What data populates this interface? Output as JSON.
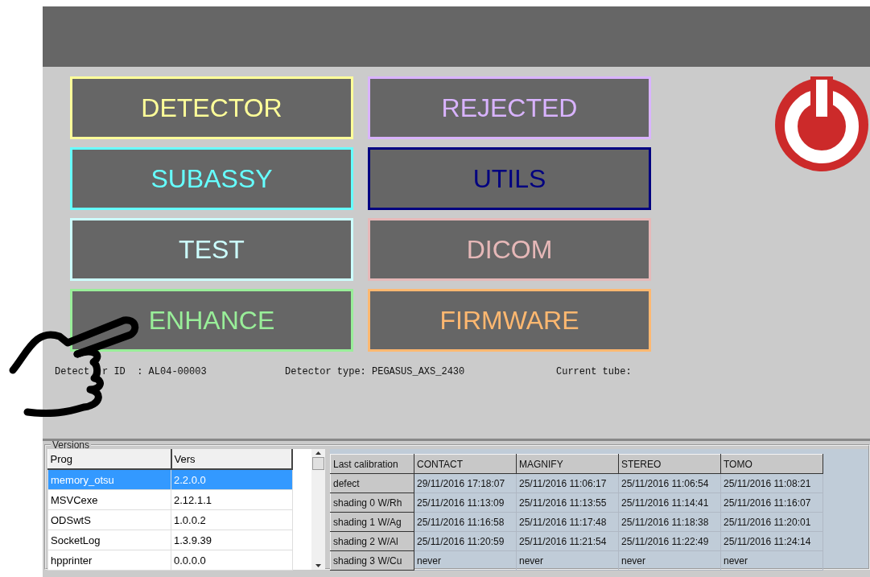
{
  "buttons": [
    {
      "label": "DETECTOR",
      "color": "#ffff99"
    },
    {
      "label": "REJECTED",
      "color": "#d9b3ff"
    },
    {
      "label": "SUBASSY",
      "color": "#66ffff"
    },
    {
      "label": "UTILS",
      "color": "#000080"
    },
    {
      "label": "TEST",
      "color": "#ccffff"
    },
    {
      "label": "DICOM",
      "color": "#e6b8b8"
    },
    {
      "label": "ENHANCE",
      "color": "#99ee99"
    },
    {
      "label": "FIRMWARE",
      "color": "#ffb870"
    }
  ],
  "info": [
    "Detect",
    "r ID  : AL04-00003",
    "Detector type: PEGASUS_AXS_2430",
    "Current tube:"
  ],
  "versions": {
    "title": "Versions",
    "columns": [
      "Prog",
      "Vers"
    ],
    "rows": [
      {
        "cells": [
          "memory_otsu",
          "2.2.0.0"
        ],
        "selected": true
      },
      {
        "cells": [
          "MSVCexe",
          "2.12.1.1"
        ],
        "selected": false
      },
      {
        "cells": [
          "ODSwtS",
          "1.0.0.2"
        ],
        "selected": false
      },
      {
        "cells": [
          "SocketLog",
          "1.3.9.39"
        ],
        "selected": false
      },
      {
        "cells": [
          "hpprinter",
          "0.0.0.0"
        ],
        "selected": false
      }
    ]
  },
  "calibration": {
    "corner": "Last calibration",
    "columns": [
      "CONTACT",
      "MAGNIFY",
      "STEREO",
      "TOMO"
    ],
    "rows": [
      {
        "label": "defect",
        "cells": [
          "29/11/2016 17:18:07",
          "25/11/2016 11:06:17",
          "25/11/2016 11:06:54",
          "25/11/2016 11:08:21"
        ]
      },
      {
        "label": "shading 0 W/Rh",
        "cells": [
          "25/11/2016 11:13:09",
          "25/11/2016 11:13:55",
          "25/11/2016 11:14:41",
          "25/11/2016 11:16:07"
        ]
      },
      {
        "label": "shading 1 W/Ag",
        "cells": [
          "25/11/2016 11:16:58",
          "25/11/2016 11:17:48",
          "25/11/2016 11:18:38",
          "25/11/2016 11:20:01"
        ]
      },
      {
        "label": "shading 2 W/Al",
        "cells": [
          "25/11/2016 11:20:59",
          "25/11/2016 11:21:54",
          "25/11/2016 11:22:49",
          "25/11/2016 11:24:14"
        ]
      },
      {
        "label": "shading 3 W/Cu",
        "cells": [
          "never",
          "never",
          "never",
          "never"
        ]
      }
    ]
  }
}
